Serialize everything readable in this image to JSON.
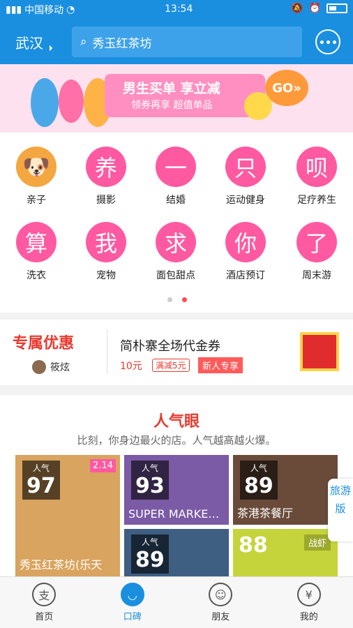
{
  "status": {
    "carrier": "中国移动",
    "time": "13:54"
  },
  "header": {
    "city": "武汉",
    "search_placeholder": "秀玉红茶坊"
  },
  "banner": {
    "line1": "男生买单 享立减",
    "line2": "领券再享 超值单品",
    "go": "GO»"
  },
  "categories": [
    {
      "label": "亲子",
      "glyph": ""
    },
    {
      "label": "摄影",
      "glyph": "养"
    },
    {
      "label": "结婚",
      "glyph": "一"
    },
    {
      "label": "运动健身",
      "glyph": "只"
    },
    {
      "label": "足疗养生",
      "glyph": "呗"
    },
    {
      "label": "洗衣",
      "glyph": "算"
    },
    {
      "label": "宠物",
      "glyph": "我"
    },
    {
      "label": "面包甜点",
      "glyph": "求"
    },
    {
      "label": "酒店预订",
      "glyph": "你"
    },
    {
      "label": "周末游",
      "glyph": "了"
    }
  ],
  "promo": {
    "tag": "专属优惠",
    "user": "筱炫",
    "title": "简朴寨全场代金券",
    "price": "10元",
    "cut": "满减5元",
    "badge": "新人专享"
  },
  "hot": {
    "title": "人气眼",
    "subtitle": "比刻，你身边最火的店。人气越高越火爆。",
    "cards": [
      {
        "score": "97",
        "name": "秀玉红茶坊(乐天",
        "date": "2.14"
      },
      {
        "score": "93",
        "name": "SUPER MARKE…"
      },
      {
        "score": "89",
        "name": "茶港茶餐厅"
      },
      {
        "score": "89",
        "name": ""
      },
      {
        "score": "88",
        "name": "战虾"
      }
    ],
    "score_label": "人气"
  },
  "side": {
    "label": "旅游版"
  },
  "tabs": [
    {
      "label": "首页",
      "icon": "支"
    },
    {
      "label": "口碑",
      "icon": "◡"
    },
    {
      "label": "朋友",
      "icon": "☺"
    },
    {
      "label": "我的",
      "icon": "¥"
    }
  ]
}
